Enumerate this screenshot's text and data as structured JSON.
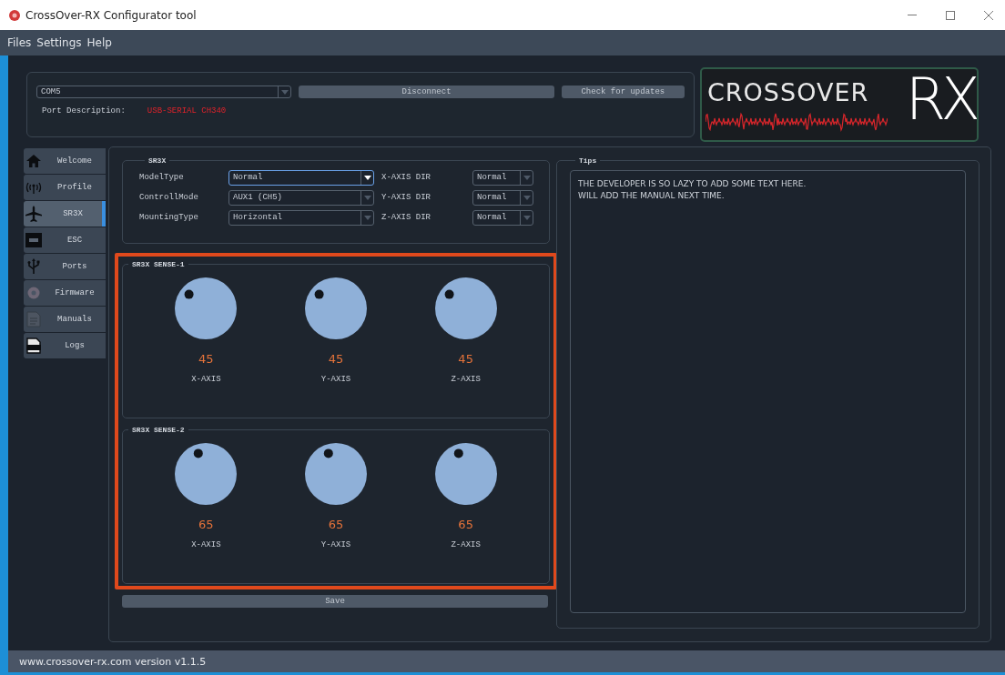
{
  "window": {
    "title": "CrossOver-RX Configurator tool"
  },
  "menu": [
    "Files",
    "Settings",
    "Help"
  ],
  "connection": {
    "port": "COM5",
    "connect_button": "Disconnect",
    "update_button": "Check for updates",
    "port_description_label": "Port Description:",
    "port_description": "USB-SERIAL CH340"
  },
  "logo": {
    "word": "CROSSOVER",
    "mark": "RX"
  },
  "sidebar": [
    {
      "label": "Welcome",
      "selected": false
    },
    {
      "label": "Profile",
      "selected": false
    },
    {
      "label": "SR3X",
      "selected": true
    },
    {
      "label": "ESC",
      "selected": false
    },
    {
      "label": "Ports",
      "selected": false
    },
    {
      "label": "Firmware",
      "selected": false
    },
    {
      "label": "Manuals",
      "selected": false
    },
    {
      "label": "Logs",
      "selected": false
    }
  ],
  "sr3x": {
    "title": "SR3X",
    "settings": [
      {
        "label": "ModelType",
        "value": "Normal",
        "focused": true,
        "axis_label": "X-AXIS DIR",
        "axis_value": "Normal"
      },
      {
        "label": "ControllMode",
        "value": "AUX1 (CH5)",
        "focused": false,
        "axis_label": "Y-AXIS DIR",
        "axis_value": "Normal"
      },
      {
        "label": "MountingType",
        "value": "Horizontal",
        "focused": false,
        "axis_label": "Z-AXIS DIR",
        "axis_value": "Normal"
      }
    ]
  },
  "sense_highlighted": true,
  "sense_groups": [
    {
      "title": "SR3X SENSE-1",
      "knobs": [
        {
          "value": "45",
          "label": "X-AXIS"
        },
        {
          "value": "45",
          "label": "Y-AXIS"
        },
        {
          "value": "45",
          "label": "Z-AXIS"
        }
      ]
    },
    {
      "title": "SR3X SENSE-2",
      "knobs": [
        {
          "value": "65",
          "label": "X-AXIS"
        },
        {
          "value": "65",
          "label": "Y-AXIS"
        },
        {
          "value": "65",
          "label": "Z-AXIS"
        }
      ]
    }
  ],
  "save_button": "Save",
  "tips": {
    "title": "Tips",
    "lines": [
      "THE DEVELOPER IS SO LAZY TO ADD SOME TEXT HERE.",
      "WILL ADD THE MANUAL NEXT TIME."
    ]
  },
  "status_bar": "www.crossover-rx.com version v1.1.5"
}
